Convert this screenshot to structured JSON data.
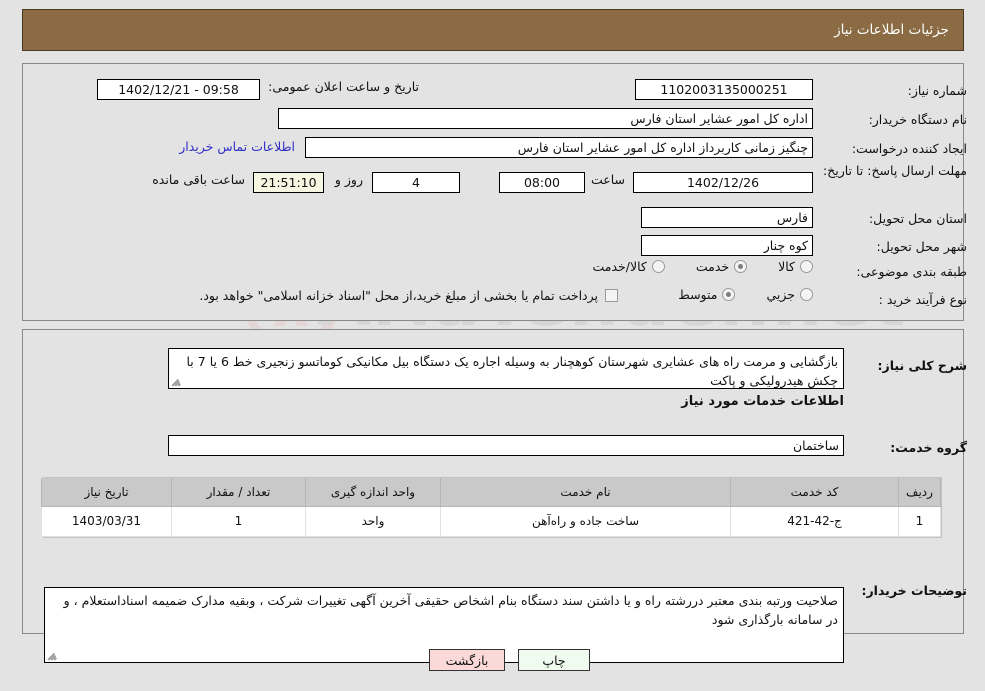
{
  "header": {
    "title": "جزئیات اطلاعات نیاز"
  },
  "top_form": {
    "need_number": {
      "label": "شماره نیاز:",
      "value": "1102003135000251"
    },
    "buyer_org": {
      "label": "نام دستگاه خریدار:",
      "value": "اداره کل امور عشایر استان فارس"
    },
    "request_creator": {
      "label": "ایجاد کننده درخواست:",
      "value": "چنگیز زمانی کاربرداز اداره کل امور عشایر استان فارس"
    },
    "public_announce": {
      "label": "تاریخ و ساعت اعلان عمومی:",
      "value": "09:58 - 1402/12/21"
    },
    "contact_link": "اطلاعات تماس خریدار",
    "deadline": {
      "label": "مهلت ارسال پاسخ: تا تاریخ:",
      "date": "1402/12/26",
      "time_label": "ساعت",
      "time": "08:00",
      "days": "4",
      "days_label": "روز و",
      "countdown": "21:51:10",
      "remaining_label": "ساعت باقی مانده"
    },
    "province": {
      "label": "استان محل تحویل:",
      "value": "فارس"
    },
    "city": {
      "label": "شهر محل تحویل:",
      "value": "کوه چنار"
    },
    "category": {
      "label": "طبقه بندی موضوعی:",
      "options": [
        "کالا",
        "خدمت",
        "کالا/خدمت"
      ],
      "selected": "خدمت"
    },
    "purchase_type": {
      "label": "نوع فرآیند خرید :",
      "options": [
        "جزیي",
        "متوسط"
      ],
      "selected": "متوسط"
    },
    "treasury_note": {
      "checked": false,
      "text": "پرداخت تمام یا بخشی از مبلغ خرید،از محل \"اسناد خزانه اسلامی\" خواهد بود."
    }
  },
  "bottom_form": {
    "need_description": {
      "label": "شرح کلی نیاز:",
      "value": "بازگشایی و مرمت راه های  عشایری  شهرستان کوهچنار  به وسیله اجاره یک دستگاه بیل مکانیکی کوماتسو زنجیری خط 6 یا 7 با چکش هیدرولیکی و پاکت"
    },
    "services_heading": "اطلاعات خدمات مورد نیاز",
    "service_group": {
      "label": "گروه خدمت:",
      "value": "ساختمان"
    },
    "table": {
      "headers": [
        "ردیف",
        "کد خدمت",
        "نام خدمت",
        "واحد اندازه گیری",
        "تعداد / مقدار",
        "تاریخ نیاز"
      ],
      "rows": [
        {
          "radif": "1",
          "code": "ج-42-421",
          "name": "ساخت جاده و راه‌آهن",
          "unit": "واحد",
          "qty": "1",
          "date": "1403/03/31"
        }
      ]
    },
    "buyer_notes": {
      "label": "توضیحات خریدار:",
      "value": "صلاحیت ورتبه بندی معتبر دررشته راه و یا داشتن سند دستگاه  بنام اشخاص حقیقی  آخرین آگهی تغییرات شرکت ، وبقیه مدارک  ضمیمه اسناداستعلام ، و در سامانه بارگذاری شود"
    }
  },
  "footer": {
    "print_label": "چاپ",
    "back_label": "بازگشت"
  },
  "watermark": {
    "text": "AriaTender.net"
  },
  "colors": {
    "header_bg": "#8b6b43",
    "page_bg": "#e3e3e3",
    "link": "#2f2fc8",
    "print_btn": "#eefbee",
    "back_btn": "#fbd9d9",
    "countdown_bg": "#f7f6e2"
  }
}
